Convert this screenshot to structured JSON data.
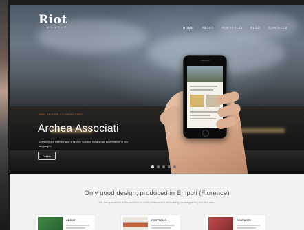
{
  "brand": {
    "logo": "Riot",
    "logo_sub": "M O B I L E"
  },
  "nav": {
    "items": [
      "Home",
      "About",
      "Portfolio",
      "Blog",
      "Contacts"
    ]
  },
  "hero": {
    "tag": "Web Design / Consulting",
    "title": "Archea Associati",
    "description": "A responsive website and a flexible solution for a small ecommerce in five languages.",
    "button_label": "Details",
    "slides_total": 5,
    "slide_active": 1
  },
  "content": {
    "headline": "Only good design, produced in Empoli (Florence)",
    "subline": "We are specialists in the creation of multi-platform and advertising campaigns for print and web."
  },
  "cards": [
    {
      "label": "About",
      "thumb_color": "#3f8a46"
    },
    {
      "label": "Portfolio",
      "thumb_color": "#c0643f"
    },
    {
      "label": "Contacts",
      "thumb_color": "#c44b4b"
    }
  ],
  "colors": {
    "accent": "#d76a4a",
    "background": "#f2f2f0",
    "hero_text": "#ffffff"
  }
}
